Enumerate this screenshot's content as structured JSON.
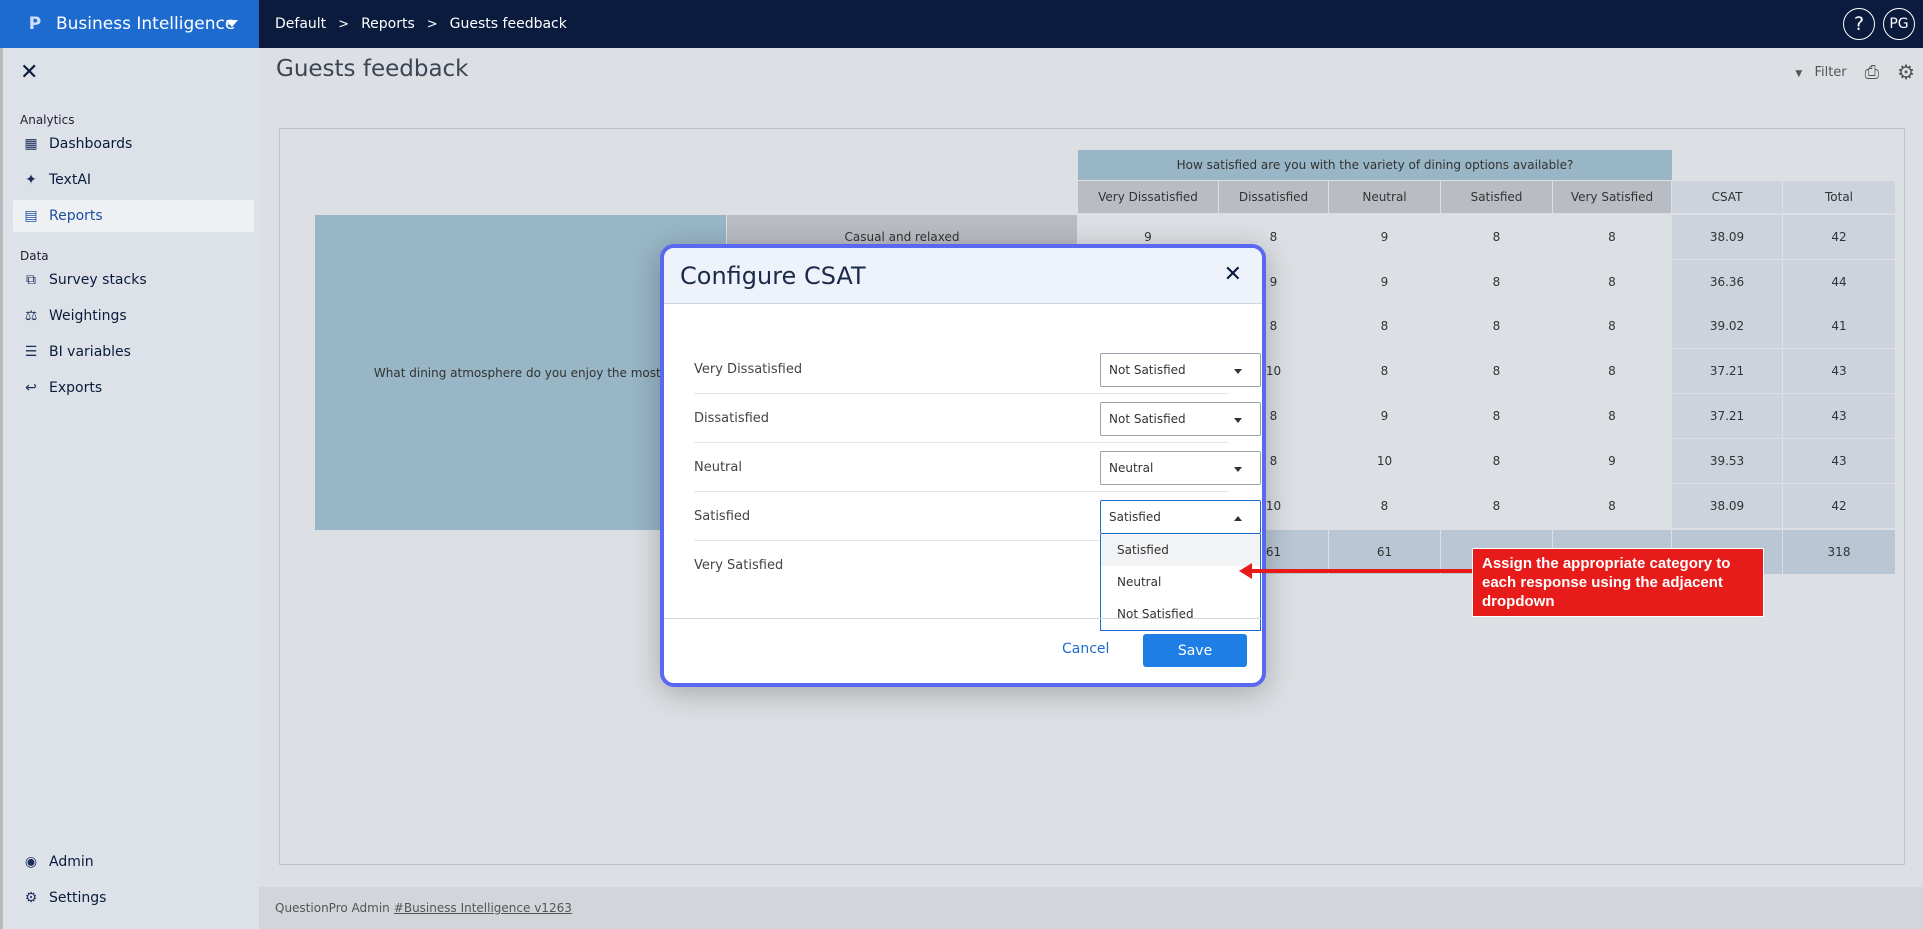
{
  "topbar": {
    "app_title": "Business Intelligence",
    "logo_glyph": "P",
    "breadcrumbs": [
      "Default",
      "Reports",
      "Guests feedback"
    ],
    "separator": ">",
    "help_label": "?",
    "user_initials": "PG"
  },
  "sidebar": {
    "close_glyph": "✕",
    "analytics_label": "Analytics",
    "data_label": "Data",
    "items": [
      {
        "label": "Dashboards",
        "icon": "dashboard-icon",
        "glyph": "▦"
      },
      {
        "label": "TextAI",
        "icon": "sparkle-icon",
        "glyph": "✦"
      },
      {
        "label": "Reports",
        "icon": "report-icon",
        "glyph": "▤"
      },
      {
        "label": "Survey stacks",
        "icon": "survey-stack-icon",
        "glyph": "⧉"
      },
      {
        "label": "Weightings",
        "icon": "scale-icon",
        "glyph": "⚖"
      },
      {
        "label": "BI variables",
        "icon": "list-icon",
        "glyph": "☰"
      },
      {
        "label": "Exports",
        "icon": "export-icon",
        "glyph": "↩"
      },
      {
        "label": "Admin",
        "icon": "admin-icon",
        "glyph": "◉"
      },
      {
        "label": "Settings",
        "icon": "gear-icon",
        "glyph": "⚙"
      }
    ],
    "active_item": "Reports"
  },
  "main": {
    "page_title": "Guests feedback",
    "filter_label": "Filter",
    "filter_glyph": "▼",
    "export_glyph": "⎙",
    "settings_glyph": "⚙",
    "footer_text": "QuestionPro Admin",
    "footer_link": "#Business Intelligence v1263"
  },
  "table": {
    "question": "How satisfied are you with the variety of dining options available?",
    "columns": [
      "Very Dissatisfied",
      "Dissatisfied",
      "Neutral",
      "Satisfied",
      "Very Satisfied",
      "CSAT",
      "Total"
    ],
    "row_question": "What dining atmosphere do you enjoy the most?",
    "first_sub_label": "Casual and relaxed",
    "rows": [
      [
        "9",
        "8",
        "9",
        "8",
        "8",
        "38.09",
        "42"
      ],
      [
        "",
        "9",
        "9",
        "8",
        "8",
        "36.36",
        "44"
      ],
      [
        "",
        "8",
        "8",
        "8",
        "8",
        "39.02",
        "41"
      ],
      [
        "",
        "10",
        "8",
        "8",
        "8",
        "37.21",
        "43"
      ],
      [
        "",
        "8",
        "9",
        "8",
        "8",
        "37.21",
        "43"
      ],
      [
        "",
        "8",
        "10",
        "8",
        "9",
        "39.53",
        "43"
      ],
      [
        "",
        "10",
        "8",
        "8",
        "8",
        "38.09",
        "42"
      ]
    ],
    "total_row": [
      "",
      "61",
      "61",
      "",
      "",
      "",
      "318"
    ]
  },
  "modal": {
    "title": "Configure CSAT",
    "close_glyph": "✕",
    "rows": [
      {
        "label": "Very Dissatisfied",
        "value": "Not Satisfied"
      },
      {
        "label": "Dissatisfied",
        "value": "Not Satisfied"
      },
      {
        "label": "Neutral",
        "value": "Neutral"
      },
      {
        "label": "Satisfied",
        "value": "Satisfied"
      },
      {
        "label": "Very Satisfied",
        "value": ""
      }
    ],
    "dropdown_options": [
      "Satisfied",
      "Neutral",
      "Not Satisfied"
    ],
    "cancel_label": "Cancel",
    "save_label": "Save"
  },
  "callout": {
    "text": "Assign the appropriate category to each response using the adjacent dropdown",
    "color": "#e81b1b"
  },
  "colors": {
    "topbar": "#0a1b3d",
    "brand": "#1e6bd0",
    "accent": "#1e7ee6",
    "modal_border": "#5a67f0"
  }
}
